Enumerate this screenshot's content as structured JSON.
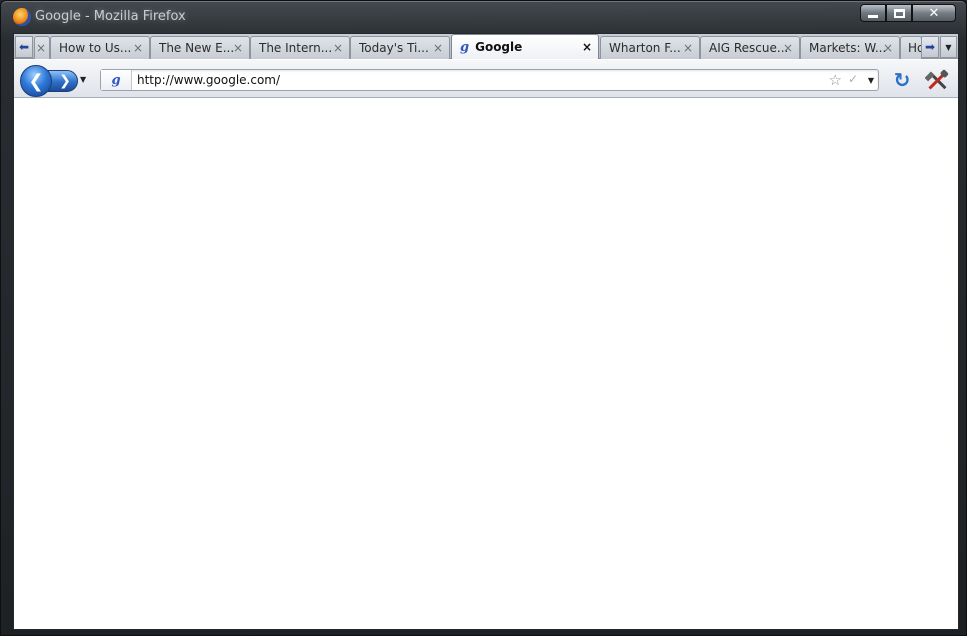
{
  "window": {
    "title": "Google - Mozilla Firefox"
  },
  "tabs": [
    {
      "label": "How to Us...",
      "selected": false
    },
    {
      "label": "The New E...",
      "selected": false
    },
    {
      "label": "The Intern...",
      "selected": false
    },
    {
      "label": "Today's Ti...",
      "selected": false
    },
    {
      "label": "Google",
      "selected": true
    },
    {
      "label": "Wharton F...",
      "selected": false
    },
    {
      "label": "AIG Rescue...",
      "selected": false
    },
    {
      "label": "Markets: W...",
      "selected": false
    },
    {
      "label": "Ho",
      "selected": false
    }
  ],
  "tab_icons": {
    "close_glyph": "×",
    "google_favicon": "g"
  },
  "navbar": {
    "url": "http://www.google.com/",
    "back_glyph": "❮",
    "forward_glyph": "❯",
    "reload_glyph": "↻",
    "star_glyph": "☆",
    "check_glyph": "✓"
  },
  "colors": {
    "accent_blue": "#2d6fc8",
    "tab_strip": "#c9ced6",
    "chrome_dark": "#25282b"
  }
}
